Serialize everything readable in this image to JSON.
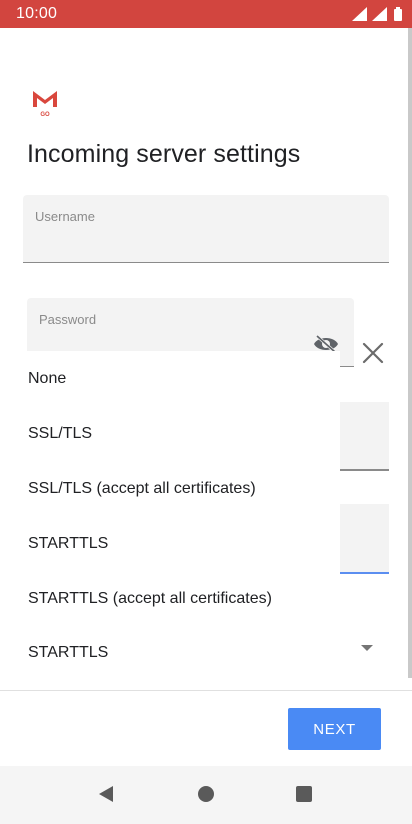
{
  "status_bar": {
    "time": "10:00",
    "icons": [
      "wifi-icon",
      "signal-icon",
      "battery-icon"
    ],
    "color": "#d2453f"
  },
  "app": {
    "logo_icon": "gmail-go-logo"
  },
  "page": {
    "title": "Incoming server settings"
  },
  "fields": {
    "username": {
      "label": "Username",
      "value": ""
    },
    "password": {
      "label": "Password",
      "value": "",
      "visibility_icon": "visibility-off-icon"
    }
  },
  "security_dropdown": {
    "options": [
      "None",
      "SSL/TLS",
      "SSL/TLS (accept all certificates)",
      "STARTTLS",
      "STARTTLS (accept all certificates)"
    ],
    "selected": "STARTTLS"
  },
  "actions": {
    "next_label": "NEXT",
    "accent_color": "#4a8af4"
  },
  "nav_bar": {
    "icons": [
      "back-icon",
      "home-icon",
      "recents-icon"
    ]
  }
}
